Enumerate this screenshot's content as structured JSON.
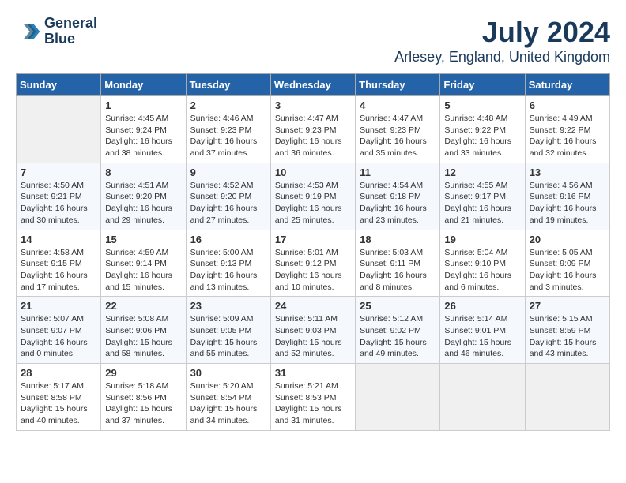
{
  "logo": {
    "line1": "General",
    "line2": "Blue"
  },
  "title": "July 2024",
  "location": "Arlesey, England, United Kingdom",
  "days_of_week": [
    "Sunday",
    "Monday",
    "Tuesday",
    "Wednesday",
    "Thursday",
    "Friday",
    "Saturday"
  ],
  "weeks": [
    [
      {
        "day": "",
        "empty": true
      },
      {
        "day": "1",
        "sunrise": "Sunrise: 4:45 AM",
        "sunset": "Sunset: 9:24 PM",
        "daylight": "Daylight: 16 hours and 38 minutes."
      },
      {
        "day": "2",
        "sunrise": "Sunrise: 4:46 AM",
        "sunset": "Sunset: 9:23 PM",
        "daylight": "Daylight: 16 hours and 37 minutes."
      },
      {
        "day": "3",
        "sunrise": "Sunrise: 4:47 AM",
        "sunset": "Sunset: 9:23 PM",
        "daylight": "Daylight: 16 hours and 36 minutes."
      },
      {
        "day": "4",
        "sunrise": "Sunrise: 4:47 AM",
        "sunset": "Sunset: 9:23 PM",
        "daylight": "Daylight: 16 hours and 35 minutes."
      },
      {
        "day": "5",
        "sunrise": "Sunrise: 4:48 AM",
        "sunset": "Sunset: 9:22 PM",
        "daylight": "Daylight: 16 hours and 33 minutes."
      },
      {
        "day": "6",
        "sunrise": "Sunrise: 4:49 AM",
        "sunset": "Sunset: 9:22 PM",
        "daylight": "Daylight: 16 hours and 32 minutes."
      }
    ],
    [
      {
        "day": "7",
        "sunrise": "Sunrise: 4:50 AM",
        "sunset": "Sunset: 9:21 PM",
        "daylight": "Daylight: 16 hours and 30 minutes."
      },
      {
        "day": "8",
        "sunrise": "Sunrise: 4:51 AM",
        "sunset": "Sunset: 9:20 PM",
        "daylight": "Daylight: 16 hours and 29 minutes."
      },
      {
        "day": "9",
        "sunrise": "Sunrise: 4:52 AM",
        "sunset": "Sunset: 9:20 PM",
        "daylight": "Daylight: 16 hours and 27 minutes."
      },
      {
        "day": "10",
        "sunrise": "Sunrise: 4:53 AM",
        "sunset": "Sunset: 9:19 PM",
        "daylight": "Daylight: 16 hours and 25 minutes."
      },
      {
        "day": "11",
        "sunrise": "Sunrise: 4:54 AM",
        "sunset": "Sunset: 9:18 PM",
        "daylight": "Daylight: 16 hours and 23 minutes."
      },
      {
        "day": "12",
        "sunrise": "Sunrise: 4:55 AM",
        "sunset": "Sunset: 9:17 PM",
        "daylight": "Daylight: 16 hours and 21 minutes."
      },
      {
        "day": "13",
        "sunrise": "Sunrise: 4:56 AM",
        "sunset": "Sunset: 9:16 PM",
        "daylight": "Daylight: 16 hours and 19 minutes."
      }
    ],
    [
      {
        "day": "14",
        "sunrise": "Sunrise: 4:58 AM",
        "sunset": "Sunset: 9:15 PM",
        "daylight": "Daylight: 16 hours and 17 minutes."
      },
      {
        "day": "15",
        "sunrise": "Sunrise: 4:59 AM",
        "sunset": "Sunset: 9:14 PM",
        "daylight": "Daylight: 16 hours and 15 minutes."
      },
      {
        "day": "16",
        "sunrise": "Sunrise: 5:00 AM",
        "sunset": "Sunset: 9:13 PM",
        "daylight": "Daylight: 16 hours and 13 minutes."
      },
      {
        "day": "17",
        "sunrise": "Sunrise: 5:01 AM",
        "sunset": "Sunset: 9:12 PM",
        "daylight": "Daylight: 16 hours and 10 minutes."
      },
      {
        "day": "18",
        "sunrise": "Sunrise: 5:03 AM",
        "sunset": "Sunset: 9:11 PM",
        "daylight": "Daylight: 16 hours and 8 minutes."
      },
      {
        "day": "19",
        "sunrise": "Sunrise: 5:04 AM",
        "sunset": "Sunset: 9:10 PM",
        "daylight": "Daylight: 16 hours and 6 minutes."
      },
      {
        "day": "20",
        "sunrise": "Sunrise: 5:05 AM",
        "sunset": "Sunset: 9:09 PM",
        "daylight": "Daylight: 16 hours and 3 minutes."
      }
    ],
    [
      {
        "day": "21",
        "sunrise": "Sunrise: 5:07 AM",
        "sunset": "Sunset: 9:07 PM",
        "daylight": "Daylight: 16 hours and 0 minutes."
      },
      {
        "day": "22",
        "sunrise": "Sunrise: 5:08 AM",
        "sunset": "Sunset: 9:06 PM",
        "daylight": "Daylight: 15 hours and 58 minutes."
      },
      {
        "day": "23",
        "sunrise": "Sunrise: 5:09 AM",
        "sunset": "Sunset: 9:05 PM",
        "daylight": "Daylight: 15 hours and 55 minutes."
      },
      {
        "day": "24",
        "sunrise": "Sunrise: 5:11 AM",
        "sunset": "Sunset: 9:03 PM",
        "daylight": "Daylight: 15 hours and 52 minutes."
      },
      {
        "day": "25",
        "sunrise": "Sunrise: 5:12 AM",
        "sunset": "Sunset: 9:02 PM",
        "daylight": "Daylight: 15 hours and 49 minutes."
      },
      {
        "day": "26",
        "sunrise": "Sunrise: 5:14 AM",
        "sunset": "Sunset: 9:01 PM",
        "daylight": "Daylight: 15 hours and 46 minutes."
      },
      {
        "day": "27",
        "sunrise": "Sunrise: 5:15 AM",
        "sunset": "Sunset: 8:59 PM",
        "daylight": "Daylight: 15 hours and 43 minutes."
      }
    ],
    [
      {
        "day": "28",
        "sunrise": "Sunrise: 5:17 AM",
        "sunset": "Sunset: 8:58 PM",
        "daylight": "Daylight: 15 hours and 40 minutes."
      },
      {
        "day": "29",
        "sunrise": "Sunrise: 5:18 AM",
        "sunset": "Sunset: 8:56 PM",
        "daylight": "Daylight: 15 hours and 37 minutes."
      },
      {
        "day": "30",
        "sunrise": "Sunrise: 5:20 AM",
        "sunset": "Sunset: 8:54 PM",
        "daylight": "Daylight: 15 hours and 34 minutes."
      },
      {
        "day": "31",
        "sunrise": "Sunrise: 5:21 AM",
        "sunset": "Sunset: 8:53 PM",
        "daylight": "Daylight: 15 hours and 31 minutes."
      },
      {
        "day": "",
        "empty": true
      },
      {
        "day": "",
        "empty": true
      },
      {
        "day": "",
        "empty": true
      }
    ]
  ]
}
